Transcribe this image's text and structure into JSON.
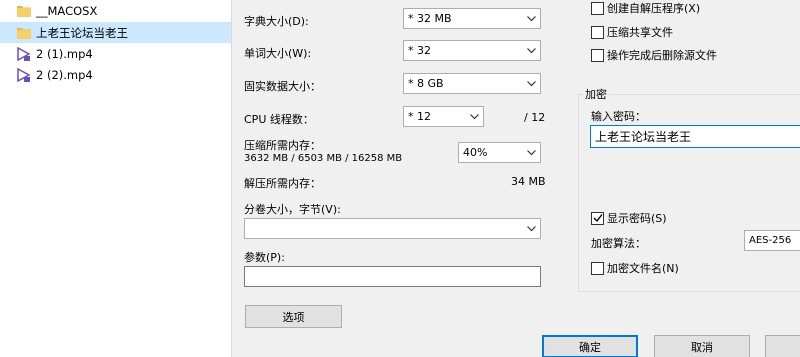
{
  "file_list": {
    "items": [
      {
        "name": "__MACOSX",
        "type": "folder",
        "selected": false
      },
      {
        "name": "上老王论坛当老王",
        "type": "folder",
        "selected": true
      },
      {
        "name": "2 (1).mp4",
        "type": "video",
        "selected": false
      },
      {
        "name": "2 (2).mp4",
        "type": "video",
        "selected": false
      }
    ]
  },
  "dialog": {
    "dictionary_size": {
      "label": "字典大小(D):",
      "value": "* 32 MB"
    },
    "word_size": {
      "label": "单词大小(W):",
      "value": "* 32"
    },
    "solid_block_size": {
      "label": "固实数据大小：",
      "value": "* 8 GB"
    },
    "cpu_threads": {
      "label": "CPU 线程数：",
      "value": "* 12",
      "max": "/ 12"
    },
    "compress_memory": {
      "label": "压缩所需内存：",
      "detail": "3632 MB / 6503 MB / 16258 MB",
      "value": "40%"
    },
    "decompress_memory": {
      "label": "解压所需内存：",
      "value": "34 MB"
    },
    "split_volumes": {
      "label": "分卷大小，字节(V):",
      "value": ""
    },
    "parameters": {
      "label": "参数(P):",
      "value": ""
    },
    "options_button": "选项",
    "checkboxes_top": [
      {
        "label": "创建自解压程序(X)",
        "checked": false
      },
      {
        "label": "压缩共享文件",
        "checked": false
      },
      {
        "label": "操作完成后删除源文件",
        "checked": false
      }
    ],
    "encryption": {
      "group_title": "加密",
      "password_label": "输入密码：",
      "password_value": "上老王论坛当老王",
      "show_password": {
        "label": "显示密码(S)",
        "checked": true
      },
      "method_label": "加密算法：",
      "method_value": "AES-256",
      "encrypt_names": {
        "label": "加密文件名(N)",
        "checked": false
      }
    },
    "ok_button": "确定",
    "cancel_button": "取消"
  }
}
